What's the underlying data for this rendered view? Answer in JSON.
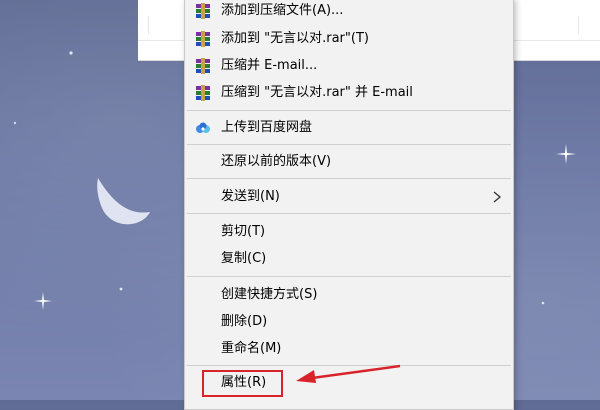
{
  "menu": {
    "items": [
      {
        "label": "添加到压缩文件(A)...",
        "icon": "winrar-icon"
      },
      {
        "label": "添加到 \"无言以对.rar\"(T)",
        "icon": "winrar-icon"
      },
      {
        "label": "压缩并 E-mail...",
        "icon": "winrar-icon"
      },
      {
        "label": "压缩到 \"无言以对.rar\" 并 E-mail",
        "icon": "winrar-icon"
      },
      {
        "label": "上传到百度网盘",
        "icon": "baidu-netdisk-icon"
      },
      {
        "label": "还原以前的版本(V)"
      },
      {
        "label": "发送到(N)",
        "has_submenu": true
      },
      {
        "label": "剪切(T)"
      },
      {
        "label": "复制(C)"
      },
      {
        "label": "创建快捷方式(S)"
      },
      {
        "label": "删除(D)"
      },
      {
        "label": "重命名(M)"
      },
      {
        "label": "属性(R)",
        "highlighted": true
      }
    ]
  },
  "colors": {
    "highlight_border": "#d8232a",
    "annotation_arrow": "#d8232a",
    "menu_background": "#f2f2f2"
  }
}
